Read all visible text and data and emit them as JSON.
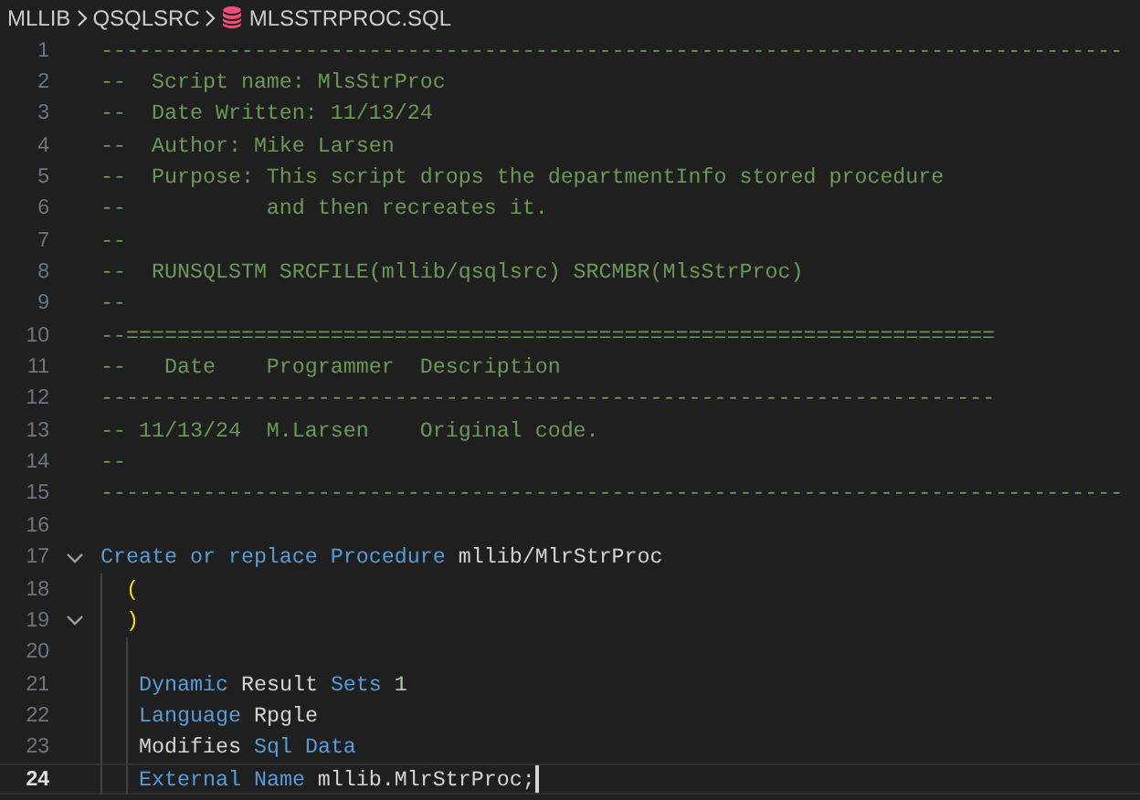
{
  "breadcrumb": [
    {
      "label": "MLLIB",
      "kind": "folder"
    },
    {
      "label": "QSQLSRC",
      "kind": "folder"
    },
    {
      "label": "MLSSTRPROC.SQL",
      "kind": "file"
    }
  ],
  "lines": [
    {
      "number": "1",
      "fold": false,
      "selected": false,
      "tokens": [
        {
          "kind": "comment",
          "text": "--------------------------------------------------------------------------------"
        }
      ]
    },
    {
      "number": "2",
      "fold": false,
      "selected": false,
      "tokens": [
        {
          "kind": "comment",
          "text": "--  Script name: MlsStrProc"
        }
      ]
    },
    {
      "number": "3",
      "fold": false,
      "selected": false,
      "tokens": [
        {
          "kind": "comment",
          "text": "--  Date Written: 11/13/24"
        }
      ]
    },
    {
      "number": "4",
      "fold": false,
      "selected": false,
      "tokens": [
        {
          "kind": "comment",
          "text": "--  Author: Mike Larsen"
        }
      ]
    },
    {
      "number": "5",
      "fold": false,
      "selected": false,
      "tokens": [
        {
          "kind": "comment",
          "text": "--  Purpose: This script drops the departmentInfo stored procedure"
        }
      ]
    },
    {
      "number": "6",
      "fold": false,
      "selected": false,
      "tokens": [
        {
          "kind": "comment",
          "text": "--           and then recreates it."
        }
      ]
    },
    {
      "number": "7",
      "fold": false,
      "selected": false,
      "tokens": [
        {
          "kind": "comment",
          "text": "--"
        }
      ]
    },
    {
      "number": "8",
      "fold": false,
      "selected": false,
      "tokens": [
        {
          "kind": "comment",
          "text": "--  RUNSQLSTM SRCFILE(mllib/qsqlsrc) SRCMBR(MlsStrProc)"
        }
      ]
    },
    {
      "number": "9",
      "fold": false,
      "selected": false,
      "tokens": [
        {
          "kind": "comment",
          "text": "--"
        }
      ]
    },
    {
      "number": "10",
      "fold": false,
      "selected": false,
      "tokens": [
        {
          "kind": "comment",
          "text": "--===================================================================="
        }
      ]
    },
    {
      "number": "11",
      "fold": false,
      "selected": false,
      "tokens": [
        {
          "kind": "comment",
          "text": "--   Date    Programmer  Description"
        }
      ]
    },
    {
      "number": "12",
      "fold": false,
      "selected": false,
      "tokens": [
        {
          "kind": "comment",
          "text": "----------------------------------------------------------------------"
        }
      ]
    },
    {
      "number": "13",
      "fold": false,
      "selected": false,
      "tokens": [
        {
          "kind": "comment",
          "text": "-- 11/13/24  M.Larsen    Original code."
        }
      ]
    },
    {
      "number": "14",
      "fold": false,
      "selected": false,
      "tokens": [
        {
          "kind": "comment",
          "text": "--"
        }
      ]
    },
    {
      "number": "15",
      "fold": false,
      "selected": false,
      "tokens": [
        {
          "kind": "comment",
          "text": "--------------------------------------------------------------------------------"
        }
      ]
    },
    {
      "number": "16",
      "fold": false,
      "selected": false
    },
    {
      "number": "17",
      "fold": true,
      "selected": false,
      "tokens": [
        {
          "kind": "keyword",
          "text": "Create or replace Procedure"
        },
        {
          "kind": "plain",
          "text": " mllib/MlrStrProc"
        }
      ],
      "children": [
        {
          "number": "18",
          "fold": false,
          "selected": false,
          "tokens": [
            {
              "kind": "paren",
              "text": "("
            }
          ]
        },
        {
          "number": "19",
          "fold": true,
          "selected": false,
          "tokens": [
            {
              "kind": "paren",
              "text": ")"
            }
          ],
          "children": [
            {
              "number": "20",
              "fold": false,
              "selected": false
            },
            {
              "number": "21",
              "fold": false,
              "selected": false,
              "tokens": [
                {
                  "kind": "keyword",
                  "text": "Dynamic"
                },
                {
                  "kind": "plain",
                  "text": " Result "
                },
                {
                  "kind": "keyword",
                  "text": "Sets"
                },
                {
                  "kind": "number",
                  "text": " 1"
                }
              ]
            },
            {
              "number": "22",
              "fold": false,
              "selected": false,
              "tokens": [
                {
                  "kind": "keyword",
                  "text": "Language"
                },
                {
                  "kind": "plain",
                  "text": " Rpgle"
                }
              ]
            },
            {
              "number": "23",
              "fold": false,
              "selected": false,
              "tokens": [
                {
                  "kind": "plain",
                  "text": "Modifies "
                },
                {
                  "kind": "keyword",
                  "text": "Sql Data"
                }
              ]
            },
            {
              "number": "24",
              "fold": false,
              "selected": true,
              "tokens": [
                {
                  "kind": "keyword",
                  "text": "External Name"
                },
                {
                  "kind": "plain",
                  "text": " mllib.MlrStrProc;"
                }
              ]
            }
          ]
        }
      ]
    }
  ]
}
